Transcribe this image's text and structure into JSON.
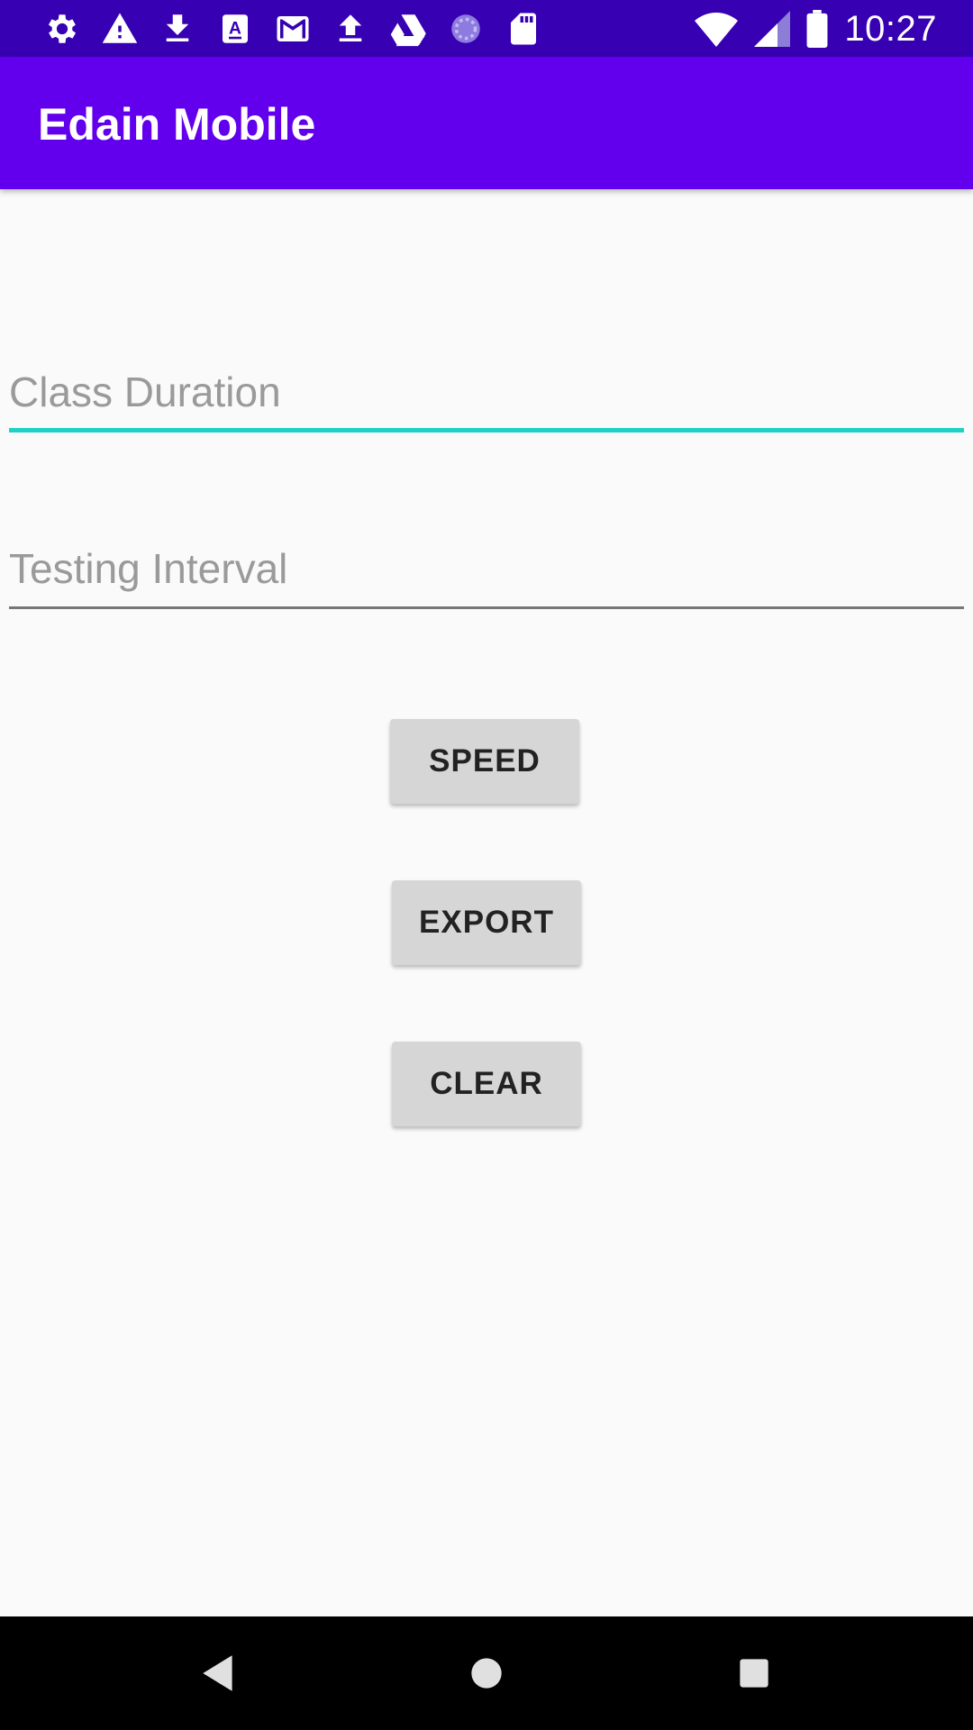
{
  "status_bar": {
    "time": "10:27",
    "left_icons": [
      "gear-icon",
      "warning-icon",
      "download-icon",
      "font-app-icon",
      "gmail-icon",
      "upload-icon",
      "drive-icon",
      "sync-progress-icon",
      "sd-card-icon"
    ],
    "right_icons": [
      "wifi-icon",
      "signal-icon",
      "battery-icon"
    ]
  },
  "app_bar": {
    "title": "Edain Mobile",
    "color": "#6200ee"
  },
  "form": {
    "class_duration": {
      "placeholder": "Class Duration",
      "value": ""
    },
    "testing_interval": {
      "placeholder": "Testing Interval",
      "value": ""
    }
  },
  "buttons": {
    "speed": "SPEED",
    "export": "EXPORT",
    "clear": "CLEAR"
  },
  "nav_bar": {
    "icons": [
      "back-icon",
      "home-icon",
      "recents-icon"
    ]
  },
  "colors": {
    "status_bar": "#3700b3",
    "accent_underline": "#1fd1c4",
    "background": "#fafafa"
  }
}
